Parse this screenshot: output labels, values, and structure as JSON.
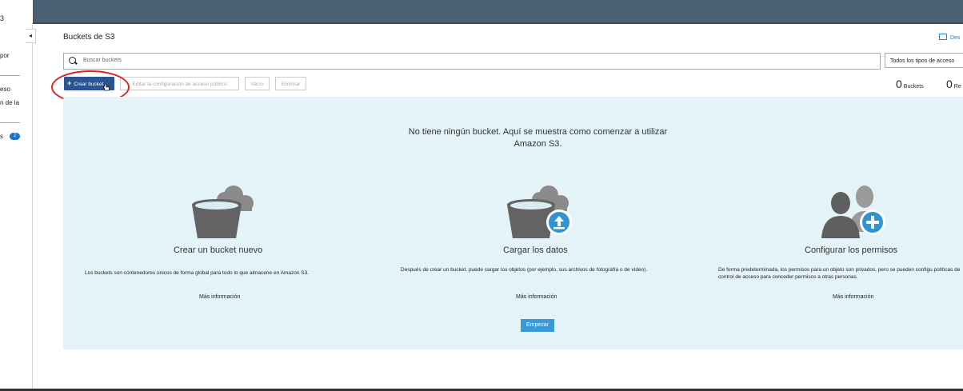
{
  "sidebar": {
    "fragments": [
      "3",
      "por",
      "eso",
      "n de la",
      "s"
    ],
    "badge": "2",
    "collapse_glyph": "◂"
  },
  "header": {
    "title": "Buckets de S3",
    "doc_link": "Des"
  },
  "search": {
    "placeholder": "Buscar buckets",
    "filter_value": "Todos los tipos de acceso"
  },
  "toolbar": {
    "create_label": "Crear bucket",
    "public_access_label": "Editar la configuración de acceso público",
    "empty_label": "Vacío",
    "delete_label": "Eliminar"
  },
  "counts": {
    "buckets_value": "0",
    "buckets_label": "Buckets",
    "regions_value": "0",
    "regions_label": "Re"
  },
  "empty_state": {
    "headline": "No tiene ningún bucket. Aquí se muestra como comenzar a utilizar Amazon S3.",
    "cards": [
      {
        "title": "Crear un bucket nuevo",
        "desc": "Los buckets son contenedores únicos de forma global para todo lo que almacene en Amazon S3.",
        "more": "Más información"
      },
      {
        "title": "Cargar los datos",
        "desc": "Después de crear un bucket, puede cargar los objetos (por ejemplo, sus archivos de fotografía o de vídeo).",
        "more": "Más información"
      },
      {
        "title": "Configurar los permisos",
        "desc": "De forma predeterminada, los permisos para un objeto son privados, pero se pueden configu políticas de control de acceso para conceder permisos a otras personas.",
        "more": "Más información"
      }
    ],
    "start_label": "Empezar"
  },
  "colors": {
    "topbar": "#4b6073",
    "primary_button": "#2b5592",
    "panel_bg": "#e4f3f7",
    "accent": "#3a9ad8",
    "highlight": "#d22222"
  }
}
